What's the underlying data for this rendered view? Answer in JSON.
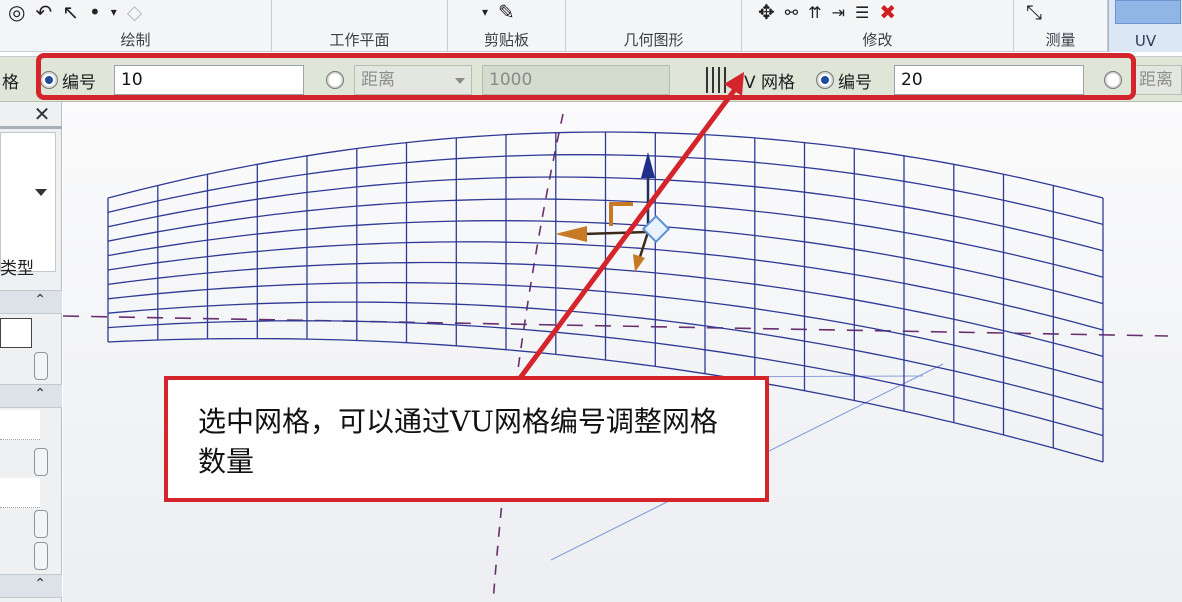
{
  "ribbon": {
    "panels": {
      "draw": "绘制",
      "work_plane": "工作平面",
      "clipboard": "剪贴板",
      "geometry": "几何图形",
      "modify": "修改",
      "measure": "测量",
      "uv": "UV"
    },
    "icons": {
      "draw_tools": [
        "ellipse-tool-icon",
        "arc-tool-icon",
        "select-pick-icon",
        "pin-icon"
      ],
      "clipboard_tools": [
        "dropdown-icon",
        "match-properties-icon"
      ],
      "modify_tools": [
        "move-icon",
        "align-icon",
        "split-icon",
        "trim-icon",
        "delete-icon"
      ],
      "measure_tools": [
        "measure-icon"
      ]
    }
  },
  "options_bar": {
    "u_grid_label": "格",
    "u_number_label": "编号",
    "u_number_value": "10",
    "u_distance_label": "距离",
    "u_distance_value": "1000",
    "v_grid_label": "V 网格",
    "v_number_label": "编号",
    "v_number_value": "20",
    "v_distance_label": "距离"
  },
  "palette": {
    "close": "✕",
    "type_label": "类型",
    "collapse_glyph": "⌃"
  },
  "annotation": {
    "callout_text": "选中网格，可以通过VU网格编号调整网格数量"
  },
  "colors": {
    "highlight": "#d4252d",
    "grid_line": "#2f3a95",
    "gizmo_orange": "#c77a26",
    "axis_dash": "#6a2f6e"
  }
}
